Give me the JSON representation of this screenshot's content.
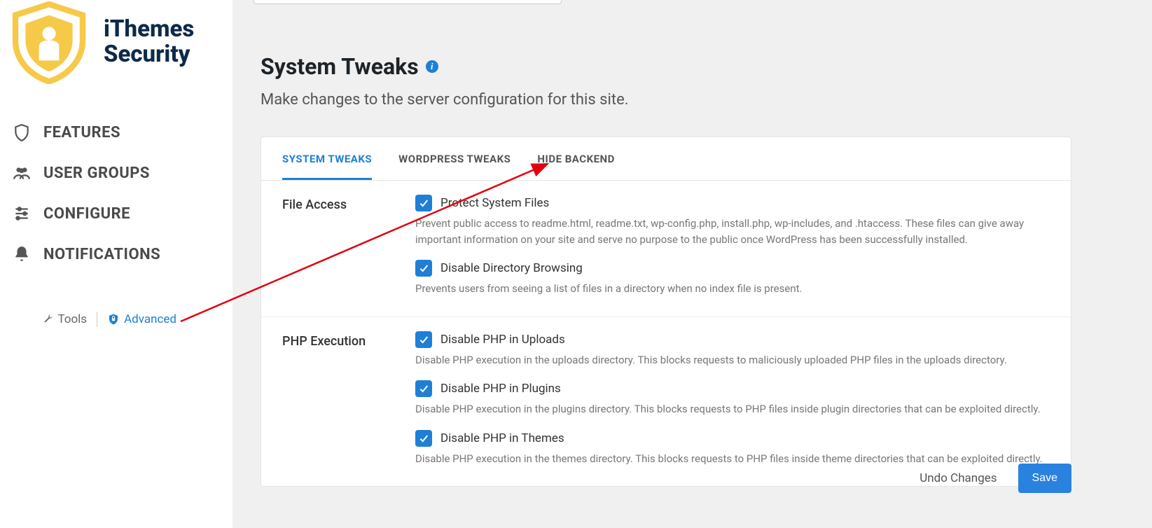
{
  "brand": {
    "line1": "iThemes",
    "line2": "Security"
  },
  "nav": [
    {
      "label": "FEATURES",
      "icon": "shield"
    },
    {
      "label": "USER GROUPS",
      "icon": "users"
    },
    {
      "label": "CONFIGURE",
      "icon": "sliders"
    },
    {
      "label": "NOTIFICATIONS",
      "icon": "bell"
    }
  ],
  "sidebar_footer": {
    "tools": "Tools",
    "advanced": "Advanced"
  },
  "page": {
    "title": "System Tweaks",
    "subtitle": "Make changes to the server configuration for this site."
  },
  "tabs": [
    {
      "label": "SYSTEM TWEAKS",
      "active": true
    },
    {
      "label": "WORDPRESS TWEAKS",
      "active": false
    },
    {
      "label": "HIDE BACKEND",
      "active": false
    }
  ],
  "sections": [
    {
      "title": "File Access",
      "items": [
        {
          "label": "Protect System Files",
          "checked": true,
          "desc": "Prevent public access to readme.html, readme.txt, wp-config.php, install.php, wp-includes, and .htaccess. These files can give away important information on your site and serve no purpose to the public once WordPress has been successfully installed."
        },
        {
          "label": "Disable Directory Browsing",
          "checked": true,
          "desc": "Prevents users from seeing a list of files in a directory when no index file is present."
        }
      ]
    },
    {
      "title": "PHP Execution",
      "items": [
        {
          "label": "Disable PHP in Uploads",
          "checked": true,
          "desc": "Disable PHP execution in the uploads directory. This blocks requests to maliciously uploaded PHP files in the uploads directory."
        },
        {
          "label": "Disable PHP in Plugins",
          "checked": true,
          "desc": "Disable PHP execution in the plugins directory. This blocks requests to PHP files inside plugin directories that can be exploited directly."
        },
        {
          "label": "Disable PHP in Themes",
          "checked": true,
          "desc": "Disable PHP execution in the themes directory. This blocks requests to PHP files inside theme directories that can be exploited directly."
        }
      ]
    }
  ],
  "footer": {
    "undo": "Undo Changes",
    "save": "Save"
  }
}
